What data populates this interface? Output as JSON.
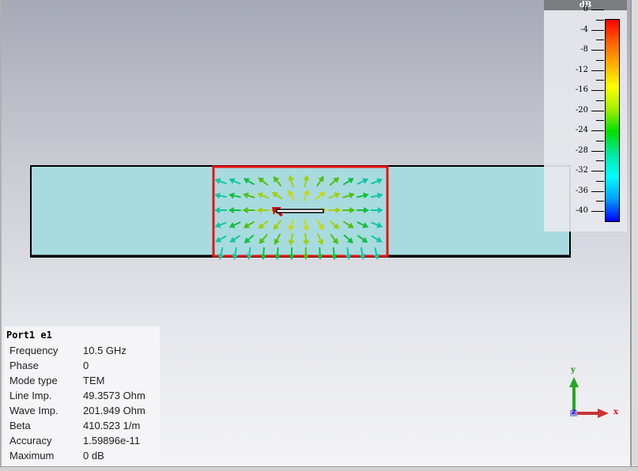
{
  "legend": {
    "unit": "dB",
    "ticks": [
      "0",
      "-4",
      "-8",
      "-12",
      "-16",
      "-20",
      "-24",
      "-28",
      "-32",
      "-36",
      "-40"
    ],
    "range": [
      -40,
      0
    ],
    "colormap": [
      "#0000ff",
      "#00a0ff",
      "#00ffff",
      "#00e8a0",
      "#00e000",
      "#a0f000",
      "#ffff00",
      "#ffb000",
      "#ff6000",
      "#ff0000"
    ]
  },
  "info": {
    "title": "Port1 e1",
    "rows": [
      {
        "key": "Frequency",
        "value": "10.5 GHz"
      },
      {
        "key": "Phase",
        "value": "0"
      },
      {
        "key": "Mode type",
        "value": "TEM"
      },
      {
        "key": "Line Imp.",
        "value": "49.3573 Ohm"
      },
      {
        "key": "Wave Imp.",
        "value": "201.949 Ohm"
      },
      {
        "key": "Beta",
        "value": "410.523 1/m"
      },
      {
        "key": "Accuracy",
        "value": "1.59896e-11"
      },
      {
        "key": "Maximum",
        "value": "0 dB"
      }
    ]
  },
  "axes": {
    "x": "x",
    "y": "y",
    "z": "z"
  },
  "colors": {
    "substrate": "#a8dbe0",
    "port_frame": "#ee1111",
    "outline": "#000000"
  }
}
